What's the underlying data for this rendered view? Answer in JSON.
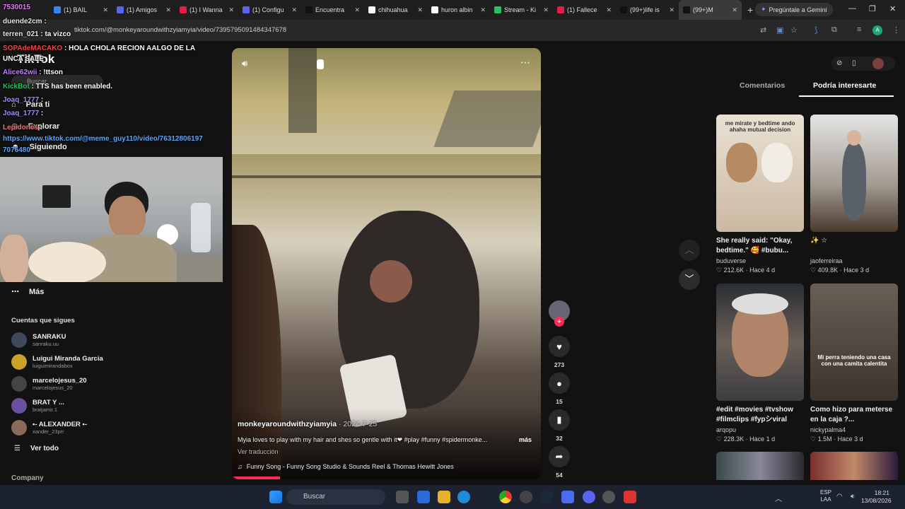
{
  "browser": {
    "tabs": [
      {
        "label": "(1) BAIL",
        "color": "#3b82f6"
      },
      {
        "label": "(1) Amigos",
        "color": "#5865f2"
      },
      {
        "label": "(1) I Wanna",
        "color": "#e11d48"
      },
      {
        "label": "(1) Configu",
        "color": "#5865f2"
      },
      {
        "label": "Encuentra",
        "color": "#111"
      },
      {
        "label": "chihuahua",
        "color": "#fff"
      },
      {
        "label": "huron albin",
        "color": "#fff"
      },
      {
        "label": "Stream - Ki",
        "color": "#22c55e"
      },
      {
        "label": "(1) Fallece",
        "color": "#e11d48"
      },
      {
        "label": "(99+)life is",
        "color": "#111"
      },
      {
        "label": "(99+)M",
        "color": "#111"
      }
    ],
    "gemini": "Pregúntale a Gemini",
    "url": "tiktok.com/@monkeyaroundwithzyiamyia/video/7395795091484347678"
  },
  "chat": [
    {
      "user": "7530015",
      "text": "",
      "color": "#e879f9"
    },
    {
      "user": "duende2cm",
      "text": " :",
      "color": "#e5e7eb"
    },
    {
      "user": "terren_021",
      "text": " : ta vizco",
      "color": "#e5e7eb"
    },
    {
      "user": "SOPAdeMACAKO",
      "text": " : HOLA CHOLA RECION AALGO DE LA",
      "color": "#ef4444"
    },
    {
      "user": "",
      "text": "UNCA SALE",
      "color": "#fff"
    },
    {
      "user": "Alice62wii",
      "text": " : !ttson",
      "color": "#c084fc"
    },
    {
      "user": "KickBot",
      "text": " : TTS has been enabled.",
      "color": "#22c55e"
    },
    {
      "user": "Joaq_1777",
      "text": " :",
      "color": "#a78bfa"
    },
    {
      "user": "Joaq_1777",
      "text": " :",
      "color": "#a78bfa"
    },
    {
      "user": "Lepidones",
      "text": " :",
      "color": "#f87171"
    },
    {
      "user": "",
      "text": "https://www.tiktok.com/@meme_guy110/video/76312806197",
      "color": "#60a5fa"
    },
    {
      "user": "",
      "text": "7076480",
      "color": "#60a5fa"
    }
  ],
  "tiktok": {
    "logo": "TikTok",
    "search": "Buscar",
    "nav": [
      "Para ti",
      "Explorar",
      "Siguiendo"
    ],
    "more": "Más",
    "following_header": "Cuentas que sigues",
    "following": [
      {
        "name": "SANRAKU",
        "handle": "sanraku.uu"
      },
      {
        "name": "Luigui Miranda Garcia",
        "handle": "luiguimirandabox"
      },
      {
        "name": "marcelojesus_20",
        "handle": "marcelojesus_20"
      },
      {
        "name": "BRAT Y ...",
        "handle": "bratjamir.1"
      },
      {
        "name": "•- ALEXANDER •-",
        "handle": "xander_23prr"
      }
    ],
    "see_all": "Ver todo",
    "company": "Company"
  },
  "video": {
    "author": "monkeyaroundwithzyiamyia",
    "date": "· 2024-7-25",
    "caption": "Myia loves to play with my hair and shes so gentle with it❤ #play #funny #spidermonke...",
    "more": "más",
    "translate": "Ver traducción",
    "music": "Funny Song - Funny Song Studio & Sounds Reel & Thomas Hewitt Jones",
    "likes": "273",
    "comments": "15",
    "saves": "32",
    "shares": "54"
  },
  "right_panel": {
    "tabs": [
      "Comentarios",
      "Podría interesarte"
    ],
    "cards": [
      {
        "title": "She really said: \"Okay, bedtime.\" 🥰 #bubu...",
        "user": "buduverse",
        "stats": "♡ 212.6K  · Hace 4 d",
        "overlay": "me mirate y bedtime ando ahaha mutual decision"
      },
      {
        "title": "✨ ☆",
        "user": "jaoferreiraa",
        "stats": "♡ 409.8K  · Hace 3 d",
        "overlay": ""
      },
      {
        "title": "#edit #movies #tvshow #filmclips #fypシviral",
        "user": "arqopu",
        "stats": "♡ 228.3K  · Hace 1 d",
        "overlay": ""
      },
      {
        "title": "Como hizo para meterse en la caja ?...",
        "user": "nickypalma4",
        "stats": "♡ 1.5M  · Hace 3 d",
        "overlay": "Mi perra teniendo una casa con una camita calentita"
      }
    ]
  },
  "taskbar": {
    "search": "Buscar",
    "lang": "ESP",
    "lang2": "LAA",
    "time": "18:21",
    "date": "13/08/2026"
  }
}
